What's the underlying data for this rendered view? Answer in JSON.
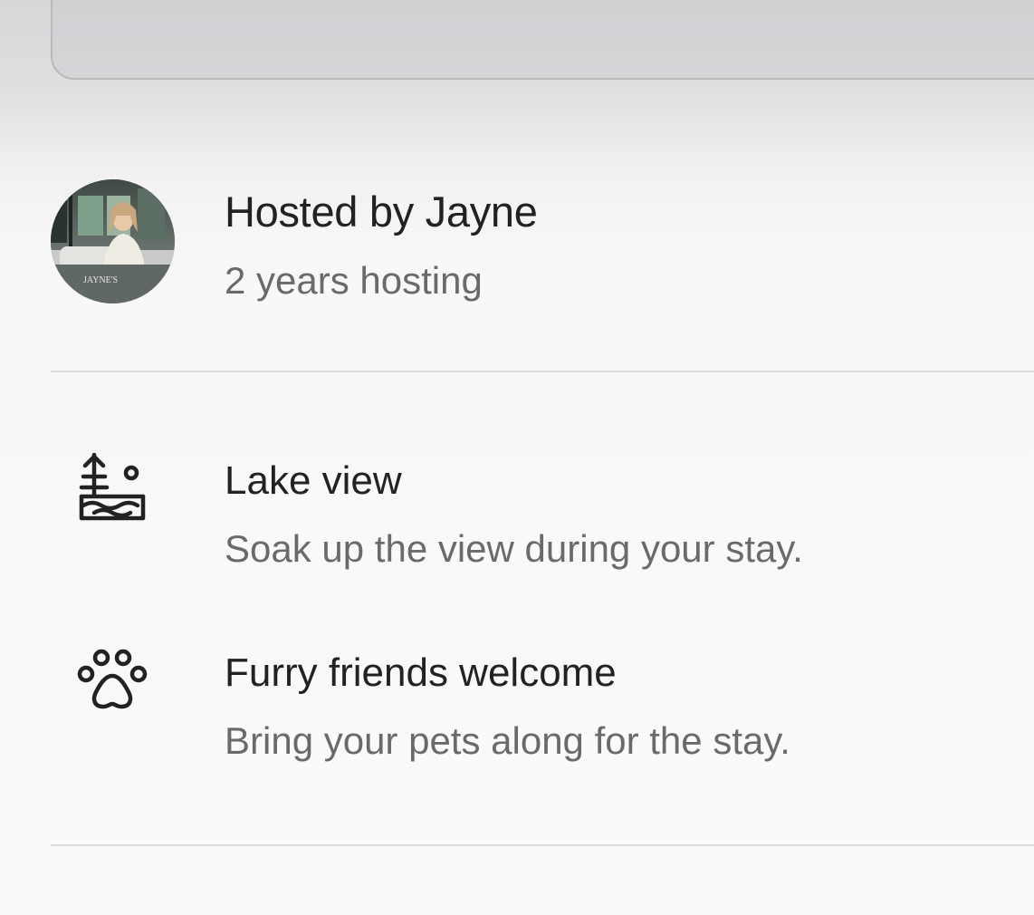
{
  "host": {
    "name": "Hosted by Jayne",
    "experience": "2 years hosting",
    "avatar_caption": "JAYNE'S"
  },
  "features": [
    {
      "icon": "lake-view-icon",
      "title": "Lake view",
      "description": "Soak up the view during your stay."
    },
    {
      "icon": "paw-icon",
      "title": "Furry friends welcome",
      "description": "Bring your pets along for the stay."
    }
  ],
  "colors": {
    "primary_text": "#222222",
    "secondary_text": "#6a6a6a",
    "divider": "#dcdcdc"
  }
}
